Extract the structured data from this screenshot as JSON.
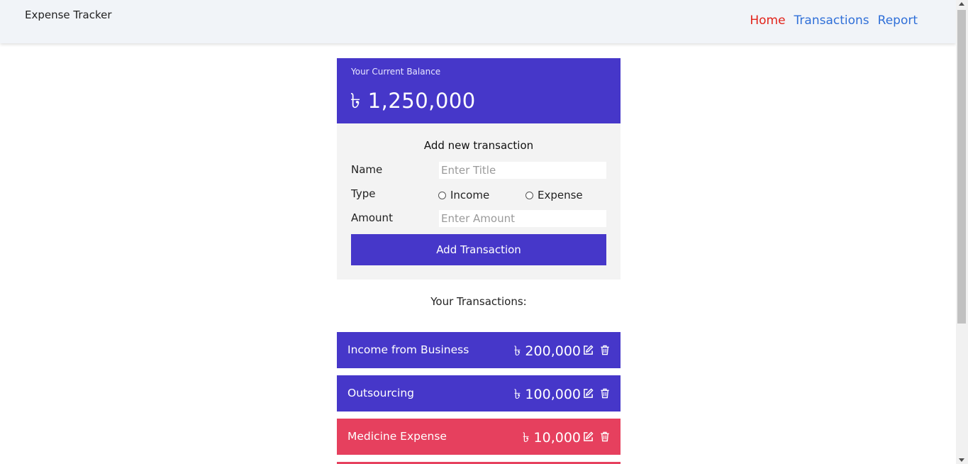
{
  "app": {
    "title": "Expense Tracker"
  },
  "nav": {
    "items": [
      {
        "label": "Home",
        "active": true
      },
      {
        "label": "Transactions",
        "active": false
      },
      {
        "label": "Report",
        "active": false
      }
    ]
  },
  "balance": {
    "label": "Your Current Balance",
    "amount": "৳ 1,250,000"
  },
  "form": {
    "heading": "Add new transaction",
    "name_label": "Name",
    "name_placeholder": "Enter Title",
    "name_value": "",
    "type_label": "Type",
    "type_options": [
      "Income",
      "Expense"
    ],
    "amount_label": "Amount",
    "amount_placeholder": "Enter Amount",
    "amount_value": "",
    "submit_label": "Add Transaction"
  },
  "transactions": {
    "heading": "Your Transactions:",
    "items": [
      {
        "name": "Income from Business",
        "amount": "৳ 200,000",
        "type": "income"
      },
      {
        "name": "Outsourcing",
        "amount": "৳ 100,000",
        "type": "income"
      },
      {
        "name": "Medicine Expense",
        "amount": "৳ 10,000",
        "type": "expense"
      }
    ]
  },
  "colors": {
    "accent": "#4637c9",
    "income": "#4637c9",
    "expense": "#e6405e",
    "nav_active": "#e2231a",
    "nav_link": "#2f6fd8"
  },
  "icons": {
    "edit": "edit-icon",
    "delete": "trash-icon"
  }
}
